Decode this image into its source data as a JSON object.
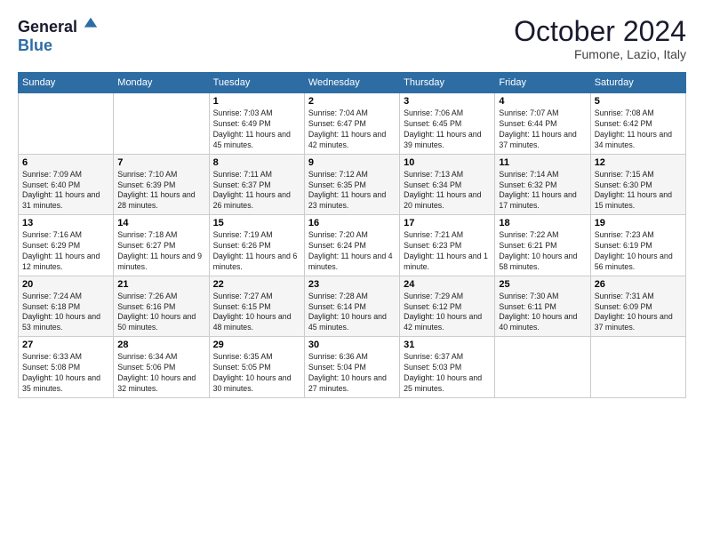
{
  "logo": {
    "line1": "General",
    "line2": "Blue"
  },
  "title": "October 2024",
  "subtitle": "Fumone, Lazio, Italy",
  "days_header": [
    "Sunday",
    "Monday",
    "Tuesday",
    "Wednesday",
    "Thursday",
    "Friday",
    "Saturday"
  ],
  "weeks": [
    [
      {
        "num": "",
        "info": ""
      },
      {
        "num": "",
        "info": ""
      },
      {
        "num": "1",
        "info": "Sunrise: 7:03 AM\nSunset: 6:49 PM\nDaylight: 11 hours and 45 minutes."
      },
      {
        "num": "2",
        "info": "Sunrise: 7:04 AM\nSunset: 6:47 PM\nDaylight: 11 hours and 42 minutes."
      },
      {
        "num": "3",
        "info": "Sunrise: 7:06 AM\nSunset: 6:45 PM\nDaylight: 11 hours and 39 minutes."
      },
      {
        "num": "4",
        "info": "Sunrise: 7:07 AM\nSunset: 6:44 PM\nDaylight: 11 hours and 37 minutes."
      },
      {
        "num": "5",
        "info": "Sunrise: 7:08 AM\nSunset: 6:42 PM\nDaylight: 11 hours and 34 minutes."
      }
    ],
    [
      {
        "num": "6",
        "info": "Sunrise: 7:09 AM\nSunset: 6:40 PM\nDaylight: 11 hours and 31 minutes."
      },
      {
        "num": "7",
        "info": "Sunrise: 7:10 AM\nSunset: 6:39 PM\nDaylight: 11 hours and 28 minutes."
      },
      {
        "num": "8",
        "info": "Sunrise: 7:11 AM\nSunset: 6:37 PM\nDaylight: 11 hours and 26 minutes."
      },
      {
        "num": "9",
        "info": "Sunrise: 7:12 AM\nSunset: 6:35 PM\nDaylight: 11 hours and 23 minutes."
      },
      {
        "num": "10",
        "info": "Sunrise: 7:13 AM\nSunset: 6:34 PM\nDaylight: 11 hours and 20 minutes."
      },
      {
        "num": "11",
        "info": "Sunrise: 7:14 AM\nSunset: 6:32 PM\nDaylight: 11 hours and 17 minutes."
      },
      {
        "num": "12",
        "info": "Sunrise: 7:15 AM\nSunset: 6:30 PM\nDaylight: 11 hours and 15 minutes."
      }
    ],
    [
      {
        "num": "13",
        "info": "Sunrise: 7:16 AM\nSunset: 6:29 PM\nDaylight: 11 hours and 12 minutes."
      },
      {
        "num": "14",
        "info": "Sunrise: 7:18 AM\nSunset: 6:27 PM\nDaylight: 11 hours and 9 minutes."
      },
      {
        "num": "15",
        "info": "Sunrise: 7:19 AM\nSunset: 6:26 PM\nDaylight: 11 hours and 6 minutes."
      },
      {
        "num": "16",
        "info": "Sunrise: 7:20 AM\nSunset: 6:24 PM\nDaylight: 11 hours and 4 minutes."
      },
      {
        "num": "17",
        "info": "Sunrise: 7:21 AM\nSunset: 6:23 PM\nDaylight: 11 hours and 1 minute."
      },
      {
        "num": "18",
        "info": "Sunrise: 7:22 AM\nSunset: 6:21 PM\nDaylight: 10 hours and 58 minutes."
      },
      {
        "num": "19",
        "info": "Sunrise: 7:23 AM\nSunset: 6:19 PM\nDaylight: 10 hours and 56 minutes."
      }
    ],
    [
      {
        "num": "20",
        "info": "Sunrise: 7:24 AM\nSunset: 6:18 PM\nDaylight: 10 hours and 53 minutes."
      },
      {
        "num": "21",
        "info": "Sunrise: 7:26 AM\nSunset: 6:16 PM\nDaylight: 10 hours and 50 minutes."
      },
      {
        "num": "22",
        "info": "Sunrise: 7:27 AM\nSunset: 6:15 PM\nDaylight: 10 hours and 48 minutes."
      },
      {
        "num": "23",
        "info": "Sunrise: 7:28 AM\nSunset: 6:14 PM\nDaylight: 10 hours and 45 minutes."
      },
      {
        "num": "24",
        "info": "Sunrise: 7:29 AM\nSunset: 6:12 PM\nDaylight: 10 hours and 42 minutes."
      },
      {
        "num": "25",
        "info": "Sunrise: 7:30 AM\nSunset: 6:11 PM\nDaylight: 10 hours and 40 minutes."
      },
      {
        "num": "26",
        "info": "Sunrise: 7:31 AM\nSunset: 6:09 PM\nDaylight: 10 hours and 37 minutes."
      }
    ],
    [
      {
        "num": "27",
        "info": "Sunrise: 6:33 AM\nSunset: 5:08 PM\nDaylight: 10 hours and 35 minutes."
      },
      {
        "num": "28",
        "info": "Sunrise: 6:34 AM\nSunset: 5:06 PM\nDaylight: 10 hours and 32 minutes."
      },
      {
        "num": "29",
        "info": "Sunrise: 6:35 AM\nSunset: 5:05 PM\nDaylight: 10 hours and 30 minutes."
      },
      {
        "num": "30",
        "info": "Sunrise: 6:36 AM\nSunset: 5:04 PM\nDaylight: 10 hours and 27 minutes."
      },
      {
        "num": "31",
        "info": "Sunrise: 6:37 AM\nSunset: 5:03 PM\nDaylight: 10 hours and 25 minutes."
      },
      {
        "num": "",
        "info": ""
      },
      {
        "num": "",
        "info": ""
      }
    ]
  ]
}
